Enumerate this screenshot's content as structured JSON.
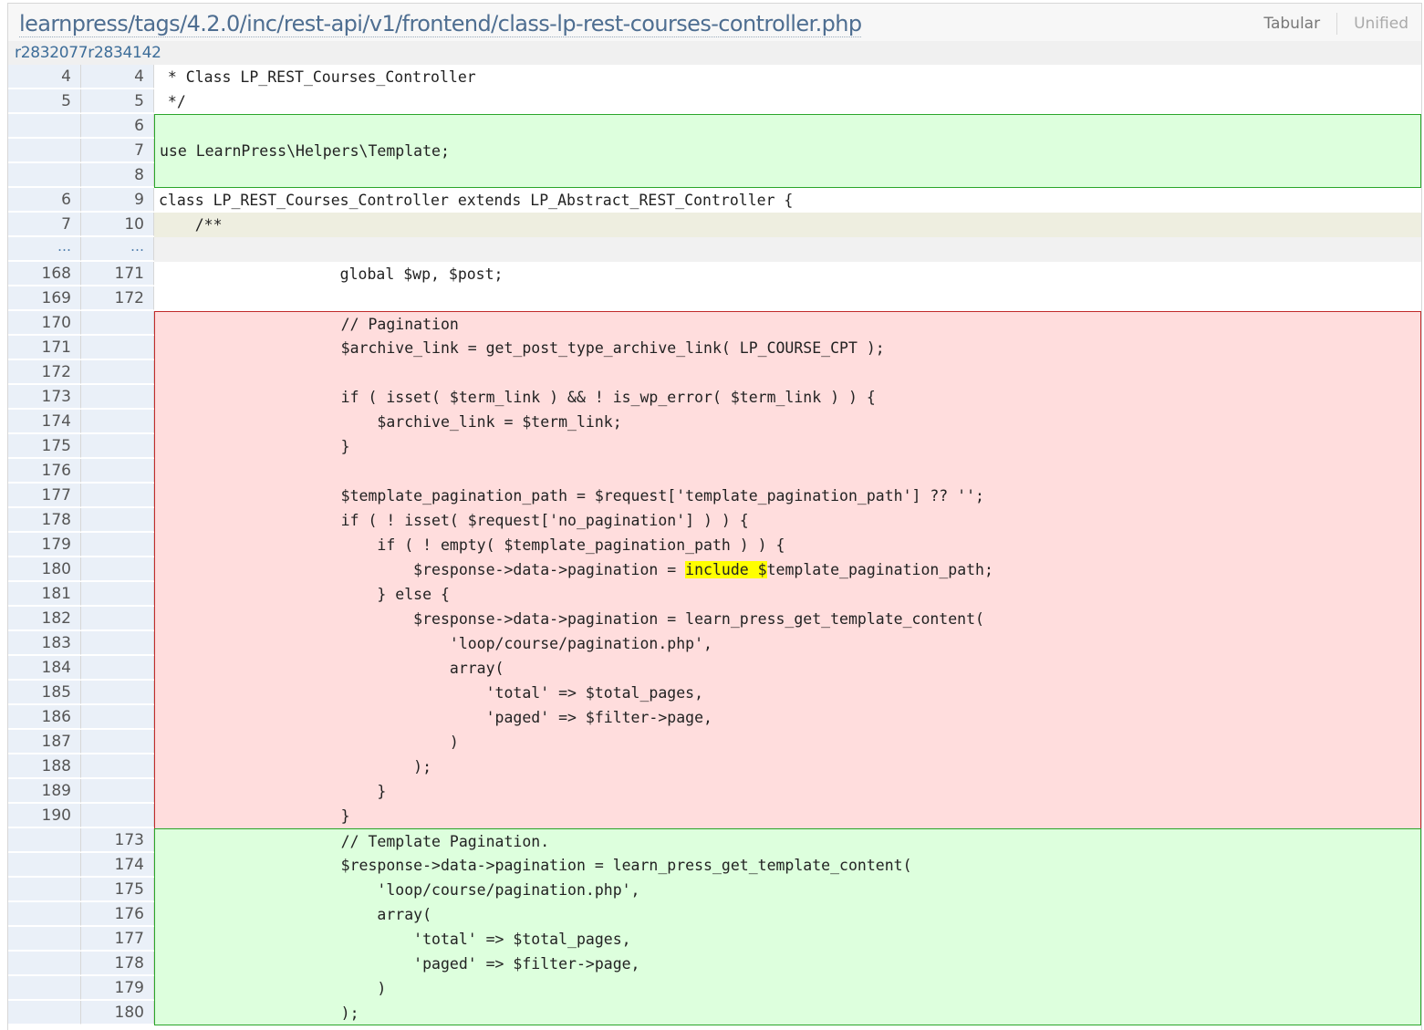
{
  "header": {
    "file_path": "learnpress/tags/4.2.0/inc/rest-api/v1/frontend/class-lp-rest-courses-controller.php",
    "view_tabular": "Tabular",
    "view_unified": "Unified"
  },
  "revisions": {
    "label": "r2832077r2834142"
  },
  "colors": {
    "added_bg": "#ddffdd",
    "added_border": "#2aa52a",
    "removed_bg": "#ffdddd",
    "removed_border": "#c02a2a",
    "line_number_bg": "#eaf0f8",
    "highlight": "#ffff00"
  },
  "diff": [
    {
      "type": "ctx",
      "old": "4",
      "new": "4",
      "code": " * Class LP_REST_Courses_Controller"
    },
    {
      "type": "ctx",
      "old": "5",
      "new": "5",
      "code": " */"
    },
    {
      "type": "add",
      "old": "",
      "new": "6",
      "code": ""
    },
    {
      "type": "add",
      "old": "",
      "new": "7",
      "code": "use LearnPress\\Helpers\\Template;"
    },
    {
      "type": "add",
      "old": "",
      "new": "8",
      "code": ""
    },
    {
      "type": "ctx",
      "old": "6",
      "new": "9",
      "code": "class LP_REST_Courses_Controller extends LP_Abstract_REST_Controller {"
    },
    {
      "type": "hl",
      "old": "7",
      "new": "10",
      "code": "    /**"
    },
    {
      "type": "sep",
      "old": "…",
      "new": "…",
      "code": ""
    },
    {
      "type": "ctx",
      "old": "168",
      "new": "171",
      "code": "                    global $wp, $post;"
    },
    {
      "type": "ctx",
      "old": "169",
      "new": "172",
      "code": ""
    },
    {
      "type": "del",
      "old": "170",
      "new": "",
      "code": "                    // Pagination"
    },
    {
      "type": "del",
      "old": "171",
      "new": "",
      "code": "                    $archive_link = get_post_type_archive_link( LP_COURSE_CPT );"
    },
    {
      "type": "del",
      "old": "172",
      "new": "",
      "code": ""
    },
    {
      "type": "del",
      "old": "173",
      "new": "",
      "code": "                    if ( isset( $term_link ) && ! is_wp_error( $term_link ) ) {"
    },
    {
      "type": "del",
      "old": "174",
      "new": "",
      "code": "                        $archive_link = $term_link;"
    },
    {
      "type": "del",
      "old": "175",
      "new": "",
      "code": "                    }"
    },
    {
      "type": "del",
      "old": "176",
      "new": "",
      "code": ""
    },
    {
      "type": "del",
      "old": "177",
      "new": "",
      "code": "                    $template_pagination_path = $request['template_pagination_path'] ?? '';"
    },
    {
      "type": "del",
      "old": "178",
      "new": "",
      "code": "                    if ( ! isset( $request['no_pagination'] ) ) {"
    },
    {
      "type": "del",
      "old": "179",
      "new": "",
      "code": "                        if ( ! empty( $template_pagination_path ) ) {"
    },
    {
      "type": "del",
      "old": "180",
      "new": "",
      "code": "                            $response->data->pagination = ",
      "mark": "include $",
      "code_after": "template_pagination_path;"
    },
    {
      "type": "del",
      "old": "181",
      "new": "",
      "code": "                        } else {"
    },
    {
      "type": "del",
      "old": "182",
      "new": "",
      "code": "                            $response->data->pagination = learn_press_get_template_content("
    },
    {
      "type": "del",
      "old": "183",
      "new": "",
      "code": "                                'loop/course/pagination.php',"
    },
    {
      "type": "del",
      "old": "184",
      "new": "",
      "code": "                                array("
    },
    {
      "type": "del",
      "old": "185",
      "new": "",
      "code": "                                    'total' => $total_pages,"
    },
    {
      "type": "del",
      "old": "186",
      "new": "",
      "code": "                                    'paged' => $filter->page,"
    },
    {
      "type": "del",
      "old": "187",
      "new": "",
      "code": "                                )"
    },
    {
      "type": "del",
      "old": "188",
      "new": "",
      "code": "                            );"
    },
    {
      "type": "del",
      "old": "189",
      "new": "",
      "code": "                        }"
    },
    {
      "type": "del",
      "old": "190",
      "new": "",
      "code": "                    }"
    },
    {
      "type": "add",
      "old": "",
      "new": "173",
      "code": "                    // Template Pagination."
    },
    {
      "type": "add",
      "old": "",
      "new": "174",
      "code": "                    $response->data->pagination = learn_press_get_template_content("
    },
    {
      "type": "add",
      "old": "",
      "new": "175",
      "code": "                        'loop/course/pagination.php',"
    },
    {
      "type": "add",
      "old": "",
      "new": "176",
      "code": "                        array("
    },
    {
      "type": "add",
      "old": "",
      "new": "177",
      "code": "                            'total' => $total_pages,"
    },
    {
      "type": "add",
      "old": "",
      "new": "178",
      "code": "                            'paged' => $filter->page,"
    },
    {
      "type": "add",
      "old": "",
      "new": "179",
      "code": "                        )"
    },
    {
      "type": "add",
      "old": "",
      "new": "180",
      "code": "                    );"
    }
  ]
}
